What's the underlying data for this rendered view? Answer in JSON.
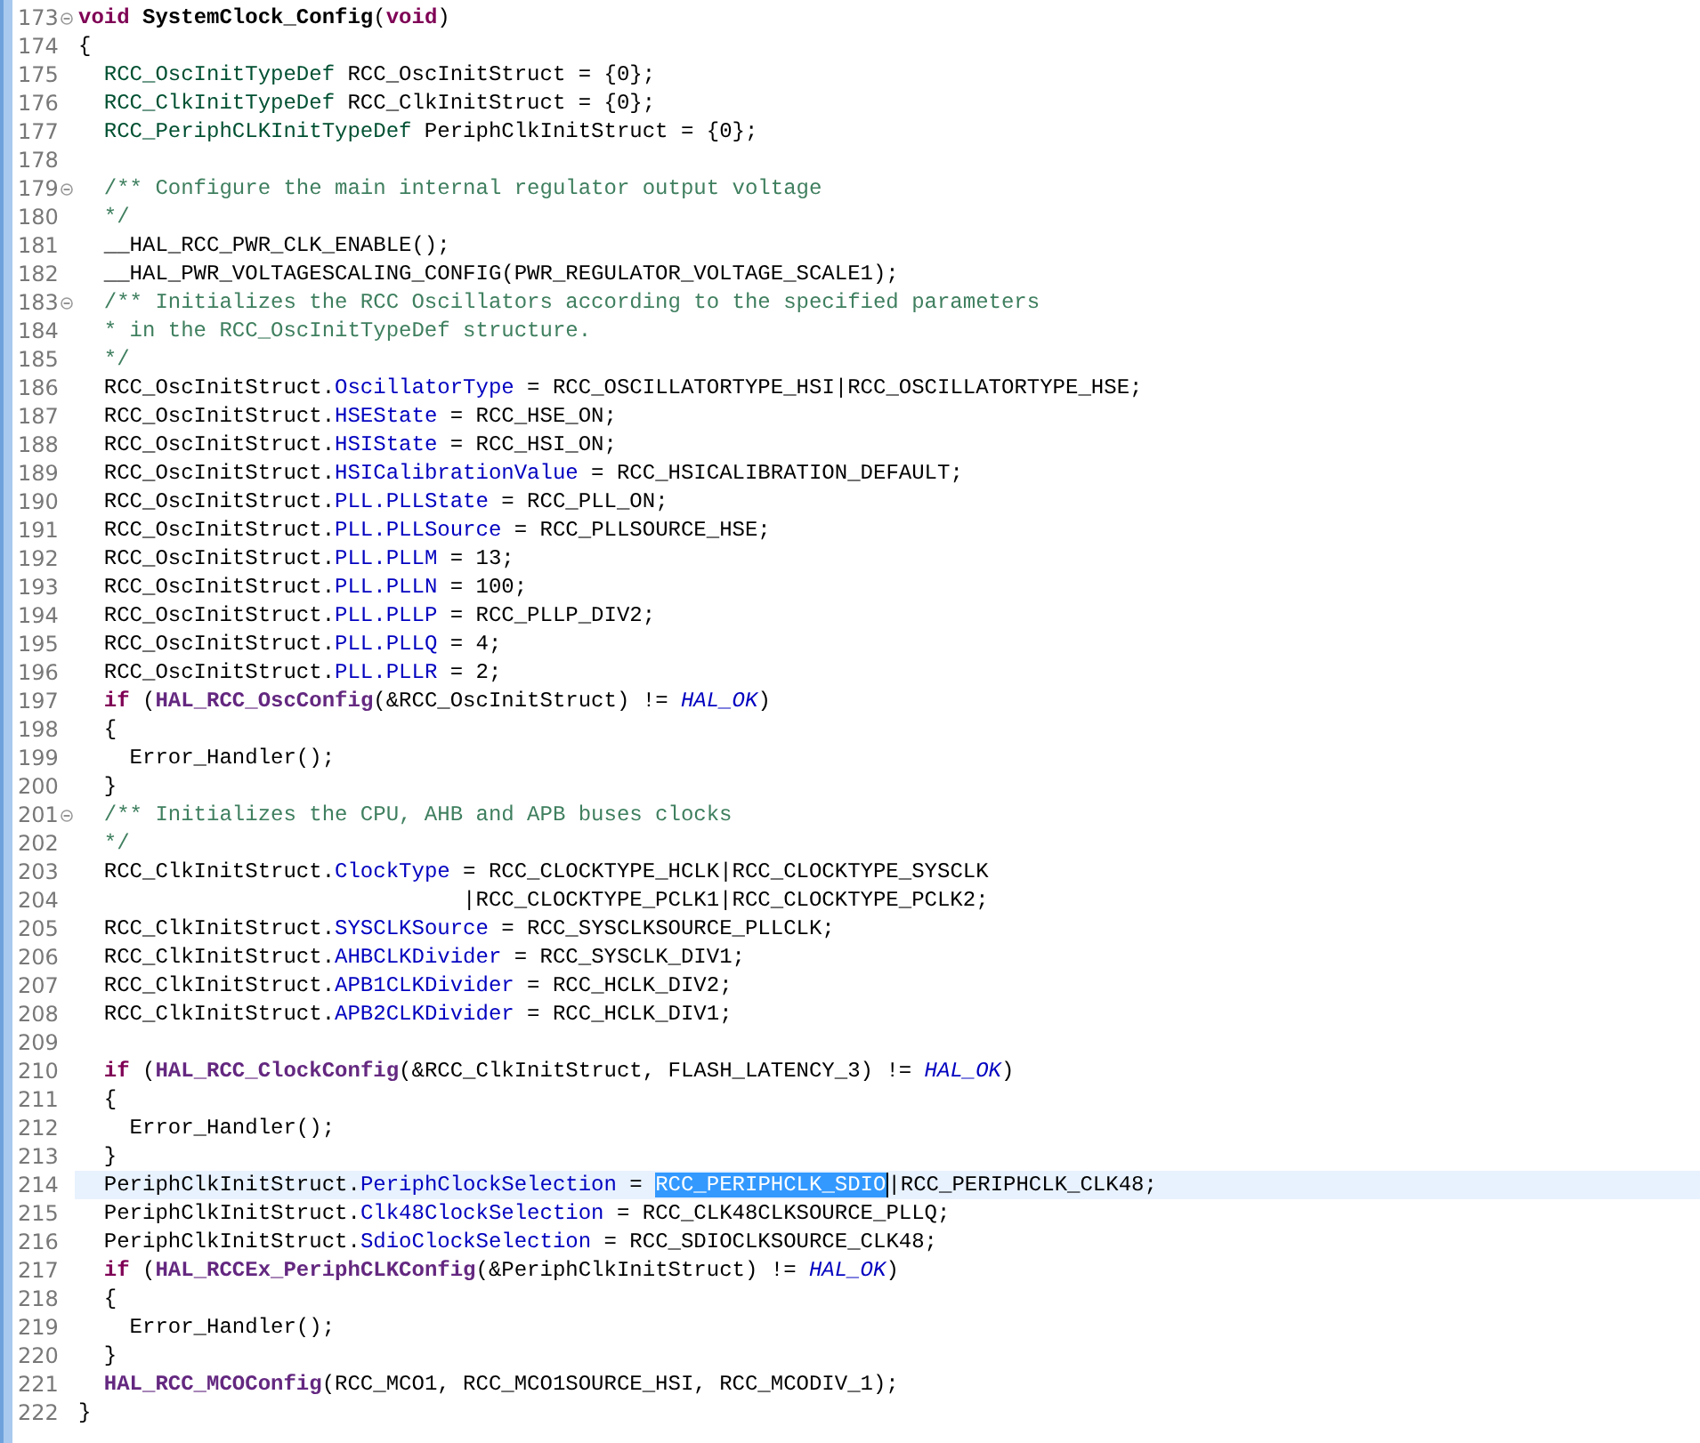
{
  "editor": {
    "lines": [
      {
        "number": "173",
        "expanded": true,
        "segments": [
          {
            "kind": "keyword",
            "text": "void"
          },
          {
            "kind": "decl",
            "text": " SystemClock_Config"
          },
          {
            "kind": "plain",
            "text": "("
          },
          {
            "kind": "keyword",
            "text": "void"
          },
          {
            "kind": "plain",
            "text": ")"
          }
        ]
      },
      {
        "number": "174",
        "segments": [
          {
            "kind": "plain",
            "text": "{"
          }
        ]
      },
      {
        "number": "175",
        "segments": [
          {
            "kind": "type",
            "text": "  RCC_OscInitTypeDef"
          },
          {
            "kind": "plain",
            "text": " RCC_OscInitStruct = {0};"
          }
        ]
      },
      {
        "number": "176",
        "segments": [
          {
            "kind": "type",
            "text": "  RCC_ClkInitTypeDef"
          },
          {
            "kind": "plain",
            "text": " RCC_ClkInitStruct = {0};"
          }
        ]
      },
      {
        "number": "177",
        "segments": [
          {
            "kind": "type",
            "text": "  RCC_PeriphCLKInitTypeDef"
          },
          {
            "kind": "plain",
            "text": " PeriphClkInitStruct = {0};"
          }
        ]
      },
      {
        "number": "178"
      },
      {
        "number": "179",
        "expanded": true,
        "segments": [
          {
            "kind": "comment",
            "text": "  /** Configure the main internal regulator output voltage"
          }
        ]
      },
      {
        "number": "180",
        "segments": [
          {
            "kind": "comment",
            "text": "  */"
          }
        ]
      },
      {
        "number": "181",
        "segments": [
          {
            "kind": "plain",
            "text": "  __HAL_RCC_PWR_CLK_ENABLE();"
          }
        ]
      },
      {
        "number": "182",
        "segments": [
          {
            "kind": "plain",
            "text": "  __HAL_PWR_VOLTAGESCALING_CONFIG(PWR_REGULATOR_VOLTAGE_SCALE1);"
          }
        ]
      },
      {
        "number": "183",
        "expanded": true,
        "segments": [
          {
            "kind": "comment",
            "text": "  /** Initializes the RCC Oscillators according to the specified parameters"
          }
        ]
      },
      {
        "number": "184",
        "segments": [
          {
            "kind": "comment",
            "text": "  * in the RCC_OscInitTypeDef structure."
          }
        ]
      },
      {
        "number": "185",
        "segments": [
          {
            "kind": "comment",
            "text": "  */"
          }
        ]
      },
      {
        "number": "186",
        "segments": [
          {
            "kind": "plain",
            "text": "  RCC_OscInitStruct."
          },
          {
            "kind": "field",
            "text": "OscillatorType"
          },
          {
            "kind": "plain",
            "text": " = RCC_OSCILLATORTYPE_HSI|RCC_OSCILLATORTYPE_HSE;"
          }
        ]
      },
      {
        "number": "187",
        "segments": [
          {
            "kind": "plain",
            "text": "  RCC_OscInitStruct."
          },
          {
            "kind": "field",
            "text": "HSEState"
          },
          {
            "kind": "plain",
            "text": " = RCC_HSE_ON;"
          }
        ]
      },
      {
        "number": "188",
        "segments": [
          {
            "kind": "plain",
            "text": "  RCC_OscInitStruct."
          },
          {
            "kind": "field",
            "text": "HSIState"
          },
          {
            "kind": "plain",
            "text": " = RCC_HSI_ON;"
          }
        ]
      },
      {
        "number": "189",
        "segments": [
          {
            "kind": "plain",
            "text": "  RCC_OscInitStruct."
          },
          {
            "kind": "field",
            "text": "HSICalibrationValue"
          },
          {
            "kind": "plain",
            "text": " = RCC_HSICALIBRATION_DEFAULT;"
          }
        ]
      },
      {
        "number": "190",
        "segments": [
          {
            "kind": "plain",
            "text": "  RCC_OscInitStruct."
          },
          {
            "kind": "field",
            "text": "PLL.PLLState"
          },
          {
            "kind": "plain",
            "text": " = RCC_PLL_ON;"
          }
        ]
      },
      {
        "number": "191",
        "segments": [
          {
            "kind": "plain",
            "text": "  RCC_OscInitStruct."
          },
          {
            "kind": "field",
            "text": "PLL.PLLSource"
          },
          {
            "kind": "plain",
            "text": " = RCC_PLLSOURCE_HSE;"
          }
        ]
      },
      {
        "number": "192",
        "segments": [
          {
            "kind": "plain",
            "text": "  RCC_OscInitStruct."
          },
          {
            "kind": "field",
            "text": "PLL.PLLM"
          },
          {
            "kind": "plain",
            "text": " = 13;"
          }
        ]
      },
      {
        "number": "193",
        "segments": [
          {
            "kind": "plain",
            "text": "  RCC_OscInitStruct."
          },
          {
            "kind": "field",
            "text": "PLL.PLLN"
          },
          {
            "kind": "plain",
            "text": " = 100;"
          }
        ]
      },
      {
        "number": "194",
        "segments": [
          {
            "kind": "plain",
            "text": "  RCC_OscInitStruct."
          },
          {
            "kind": "field",
            "text": "PLL.PLLP"
          },
          {
            "kind": "plain",
            "text": " = RCC_PLLP_DIV2;"
          }
        ]
      },
      {
        "number": "195",
        "segments": [
          {
            "kind": "plain",
            "text": "  RCC_OscInitStruct."
          },
          {
            "kind": "field",
            "text": "PLL.PLLQ"
          },
          {
            "kind": "plain",
            "text": " = 4;"
          }
        ]
      },
      {
        "number": "196",
        "segments": [
          {
            "kind": "plain",
            "text": "  RCC_OscInitStruct."
          },
          {
            "kind": "field",
            "text": "PLL.PLLR"
          },
          {
            "kind": "plain",
            "text": " = 2;"
          }
        ]
      },
      {
        "number": "197",
        "segments": [
          {
            "kind": "keyword",
            "text": "  if"
          },
          {
            "kind": "plain",
            "text": " ("
          },
          {
            "kind": "func",
            "text": "HAL_RCC_OscConfig"
          },
          {
            "kind": "plain",
            "text": "(&RCC_OscInitStruct) != "
          },
          {
            "kind": "constant",
            "text": "HAL_OK"
          },
          {
            "kind": "plain",
            "text": ")"
          }
        ]
      },
      {
        "number": "198",
        "segments": [
          {
            "kind": "plain",
            "text": "  {"
          }
        ]
      },
      {
        "number": "199",
        "segments": [
          {
            "kind": "plain",
            "text": "    Error_Handler();"
          }
        ]
      },
      {
        "number": "200",
        "segments": [
          {
            "kind": "plain",
            "text": "  }"
          }
        ]
      },
      {
        "number": "201",
        "expanded": true,
        "segments": [
          {
            "kind": "comment",
            "text": "  /** Initializes the CPU, AHB and APB buses clocks"
          }
        ]
      },
      {
        "number": "202",
        "segments": [
          {
            "kind": "comment",
            "text": "  */"
          }
        ]
      },
      {
        "number": "203",
        "segments": [
          {
            "kind": "plain",
            "text": "  RCC_ClkInitStruct."
          },
          {
            "kind": "field",
            "text": "ClockType"
          },
          {
            "kind": "plain",
            "text": " = RCC_CLOCKTYPE_HCLK|RCC_CLOCKTYPE_SYSCLK"
          }
        ]
      },
      {
        "number": "204",
        "segments": [
          {
            "kind": "plain",
            "text": "                              |RCC_CLOCKTYPE_PCLK1|RCC_CLOCKTYPE_PCLK2;"
          }
        ]
      },
      {
        "number": "205",
        "segments": [
          {
            "kind": "plain",
            "text": "  RCC_ClkInitStruct."
          },
          {
            "kind": "field",
            "text": "SYSCLKSource"
          },
          {
            "kind": "plain",
            "text": " = RCC_SYSCLKSOURCE_PLLCLK;"
          }
        ]
      },
      {
        "number": "206",
        "segments": [
          {
            "kind": "plain",
            "text": "  RCC_ClkInitStruct."
          },
          {
            "kind": "field",
            "text": "AHBCLKDivider"
          },
          {
            "kind": "plain",
            "text": " = RCC_SYSCLK_DIV1;"
          }
        ]
      },
      {
        "number": "207",
        "segments": [
          {
            "kind": "plain",
            "text": "  RCC_ClkInitStruct."
          },
          {
            "kind": "field",
            "text": "APB1CLKDivider"
          },
          {
            "kind": "plain",
            "text": " = RCC_HCLK_DIV2;"
          }
        ]
      },
      {
        "number": "208",
        "segments": [
          {
            "kind": "plain",
            "text": "  RCC_ClkInitStruct."
          },
          {
            "kind": "field",
            "text": "APB2CLKDivider"
          },
          {
            "kind": "plain",
            "text": " = RCC_HCLK_DIV1;"
          }
        ]
      },
      {
        "number": "209"
      },
      {
        "number": "210",
        "segments": [
          {
            "kind": "keyword",
            "text": "  if"
          },
          {
            "kind": "plain",
            "text": " ("
          },
          {
            "kind": "func",
            "text": "HAL_RCC_ClockConfig"
          },
          {
            "kind": "plain",
            "text": "(&RCC_ClkInitStruct, FLASH_LATENCY_3) != "
          },
          {
            "kind": "constant",
            "text": "HAL_OK"
          },
          {
            "kind": "plain",
            "text": ")"
          }
        ]
      },
      {
        "number": "211",
        "segments": [
          {
            "kind": "plain",
            "text": "  {"
          }
        ]
      },
      {
        "number": "212",
        "segments": [
          {
            "kind": "plain",
            "text": "    Error_Handler();"
          }
        ]
      },
      {
        "number": "213",
        "segments": [
          {
            "kind": "plain",
            "text": "  }"
          }
        ]
      },
      {
        "number": "214",
        "current": true,
        "segments": [
          {
            "kind": "plain",
            "text": "  PeriphClkInitStruct."
          },
          {
            "kind": "field",
            "text": "PeriphClockSelection"
          },
          {
            "kind": "plain",
            "text": " = "
          },
          {
            "kind": "selection",
            "text": "RCC_PERIPHCLK_SDIO"
          },
          {
            "kind": "plain",
            "text": "|RCC_PERIPHCLK_CLK48;"
          }
        ]
      },
      {
        "number": "215",
        "segments": [
          {
            "kind": "plain",
            "text": "  PeriphClkInitStruct."
          },
          {
            "kind": "field",
            "text": "Clk48ClockSelection"
          },
          {
            "kind": "plain",
            "text": " = RCC_CLK48CLKSOURCE_PLLQ;"
          }
        ]
      },
      {
        "number": "216",
        "segments": [
          {
            "kind": "plain",
            "text": "  PeriphClkInitStruct."
          },
          {
            "kind": "field",
            "text": "SdioClockSelection"
          },
          {
            "kind": "plain",
            "text": " = RCC_SDIOCLKSOURCE_CLK48;"
          }
        ]
      },
      {
        "number": "217",
        "segments": [
          {
            "kind": "keyword",
            "text": "  if"
          },
          {
            "kind": "plain",
            "text": " ("
          },
          {
            "kind": "func",
            "text": "HAL_RCCEx_PeriphCLKConfig"
          },
          {
            "kind": "plain",
            "text": "(&PeriphClkInitStruct) != "
          },
          {
            "kind": "constant",
            "text": "HAL_OK"
          },
          {
            "kind": "plain",
            "text": ")"
          }
        ]
      },
      {
        "number": "218",
        "segments": [
          {
            "kind": "plain",
            "text": "  {"
          }
        ]
      },
      {
        "number": "219",
        "segments": [
          {
            "kind": "plain",
            "text": "    Error_Handler();"
          }
        ]
      },
      {
        "number": "220",
        "segments": [
          {
            "kind": "plain",
            "text": "  }"
          }
        ]
      },
      {
        "number": "221",
        "segments": [
          {
            "kind": "func",
            "text": "  HAL_RCC_MCOConfig"
          },
          {
            "kind": "plain",
            "text": "(RCC_MCO1, RCC_MCO1SOURCE_HSI, RCC_MCODIV_1);"
          }
        ]
      },
      {
        "number": "222",
        "segments": [
          {
            "kind": "plain",
            "text": "}"
          }
        ]
      }
    ]
  }
}
